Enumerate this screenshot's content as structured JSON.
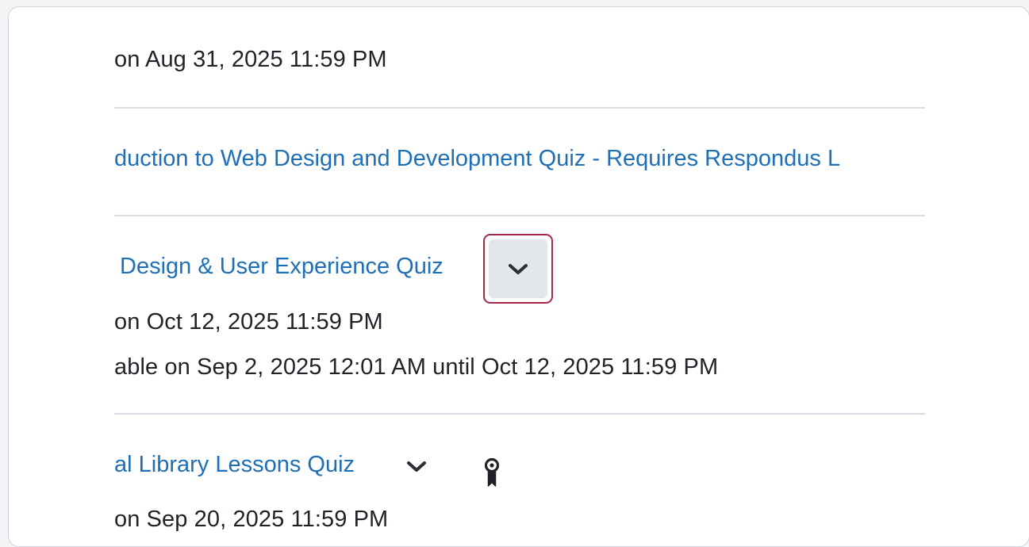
{
  "items": {
    "prev_due": "on Aug 31, 2025 11:59 PM",
    "quiz_web_design_title": "duction to Web Design and Development Quiz - Requires Respondus L",
    "quiz_ux_title": "Design & User Experience Quiz",
    "quiz_ux_due": "on Oct 12, 2025 11:59 PM",
    "quiz_ux_availability": "able on Sep 2, 2025 12:01 AM until Oct 12, 2025 11:59 PM",
    "quiz_library_title": "al Library Lessons Quiz",
    "quiz_library_due": "on Sep 20, 2025 11:59 PM"
  },
  "icons": {
    "actions_menu": "chevron-down-icon",
    "release_condition": "ribbon-award-icon"
  },
  "colors": {
    "link": "#1e6fb6",
    "text": "#1f2328",
    "highlight_border": "#a52a47",
    "button_bg": "#e3e6eb",
    "divider": "#d9dde3"
  }
}
